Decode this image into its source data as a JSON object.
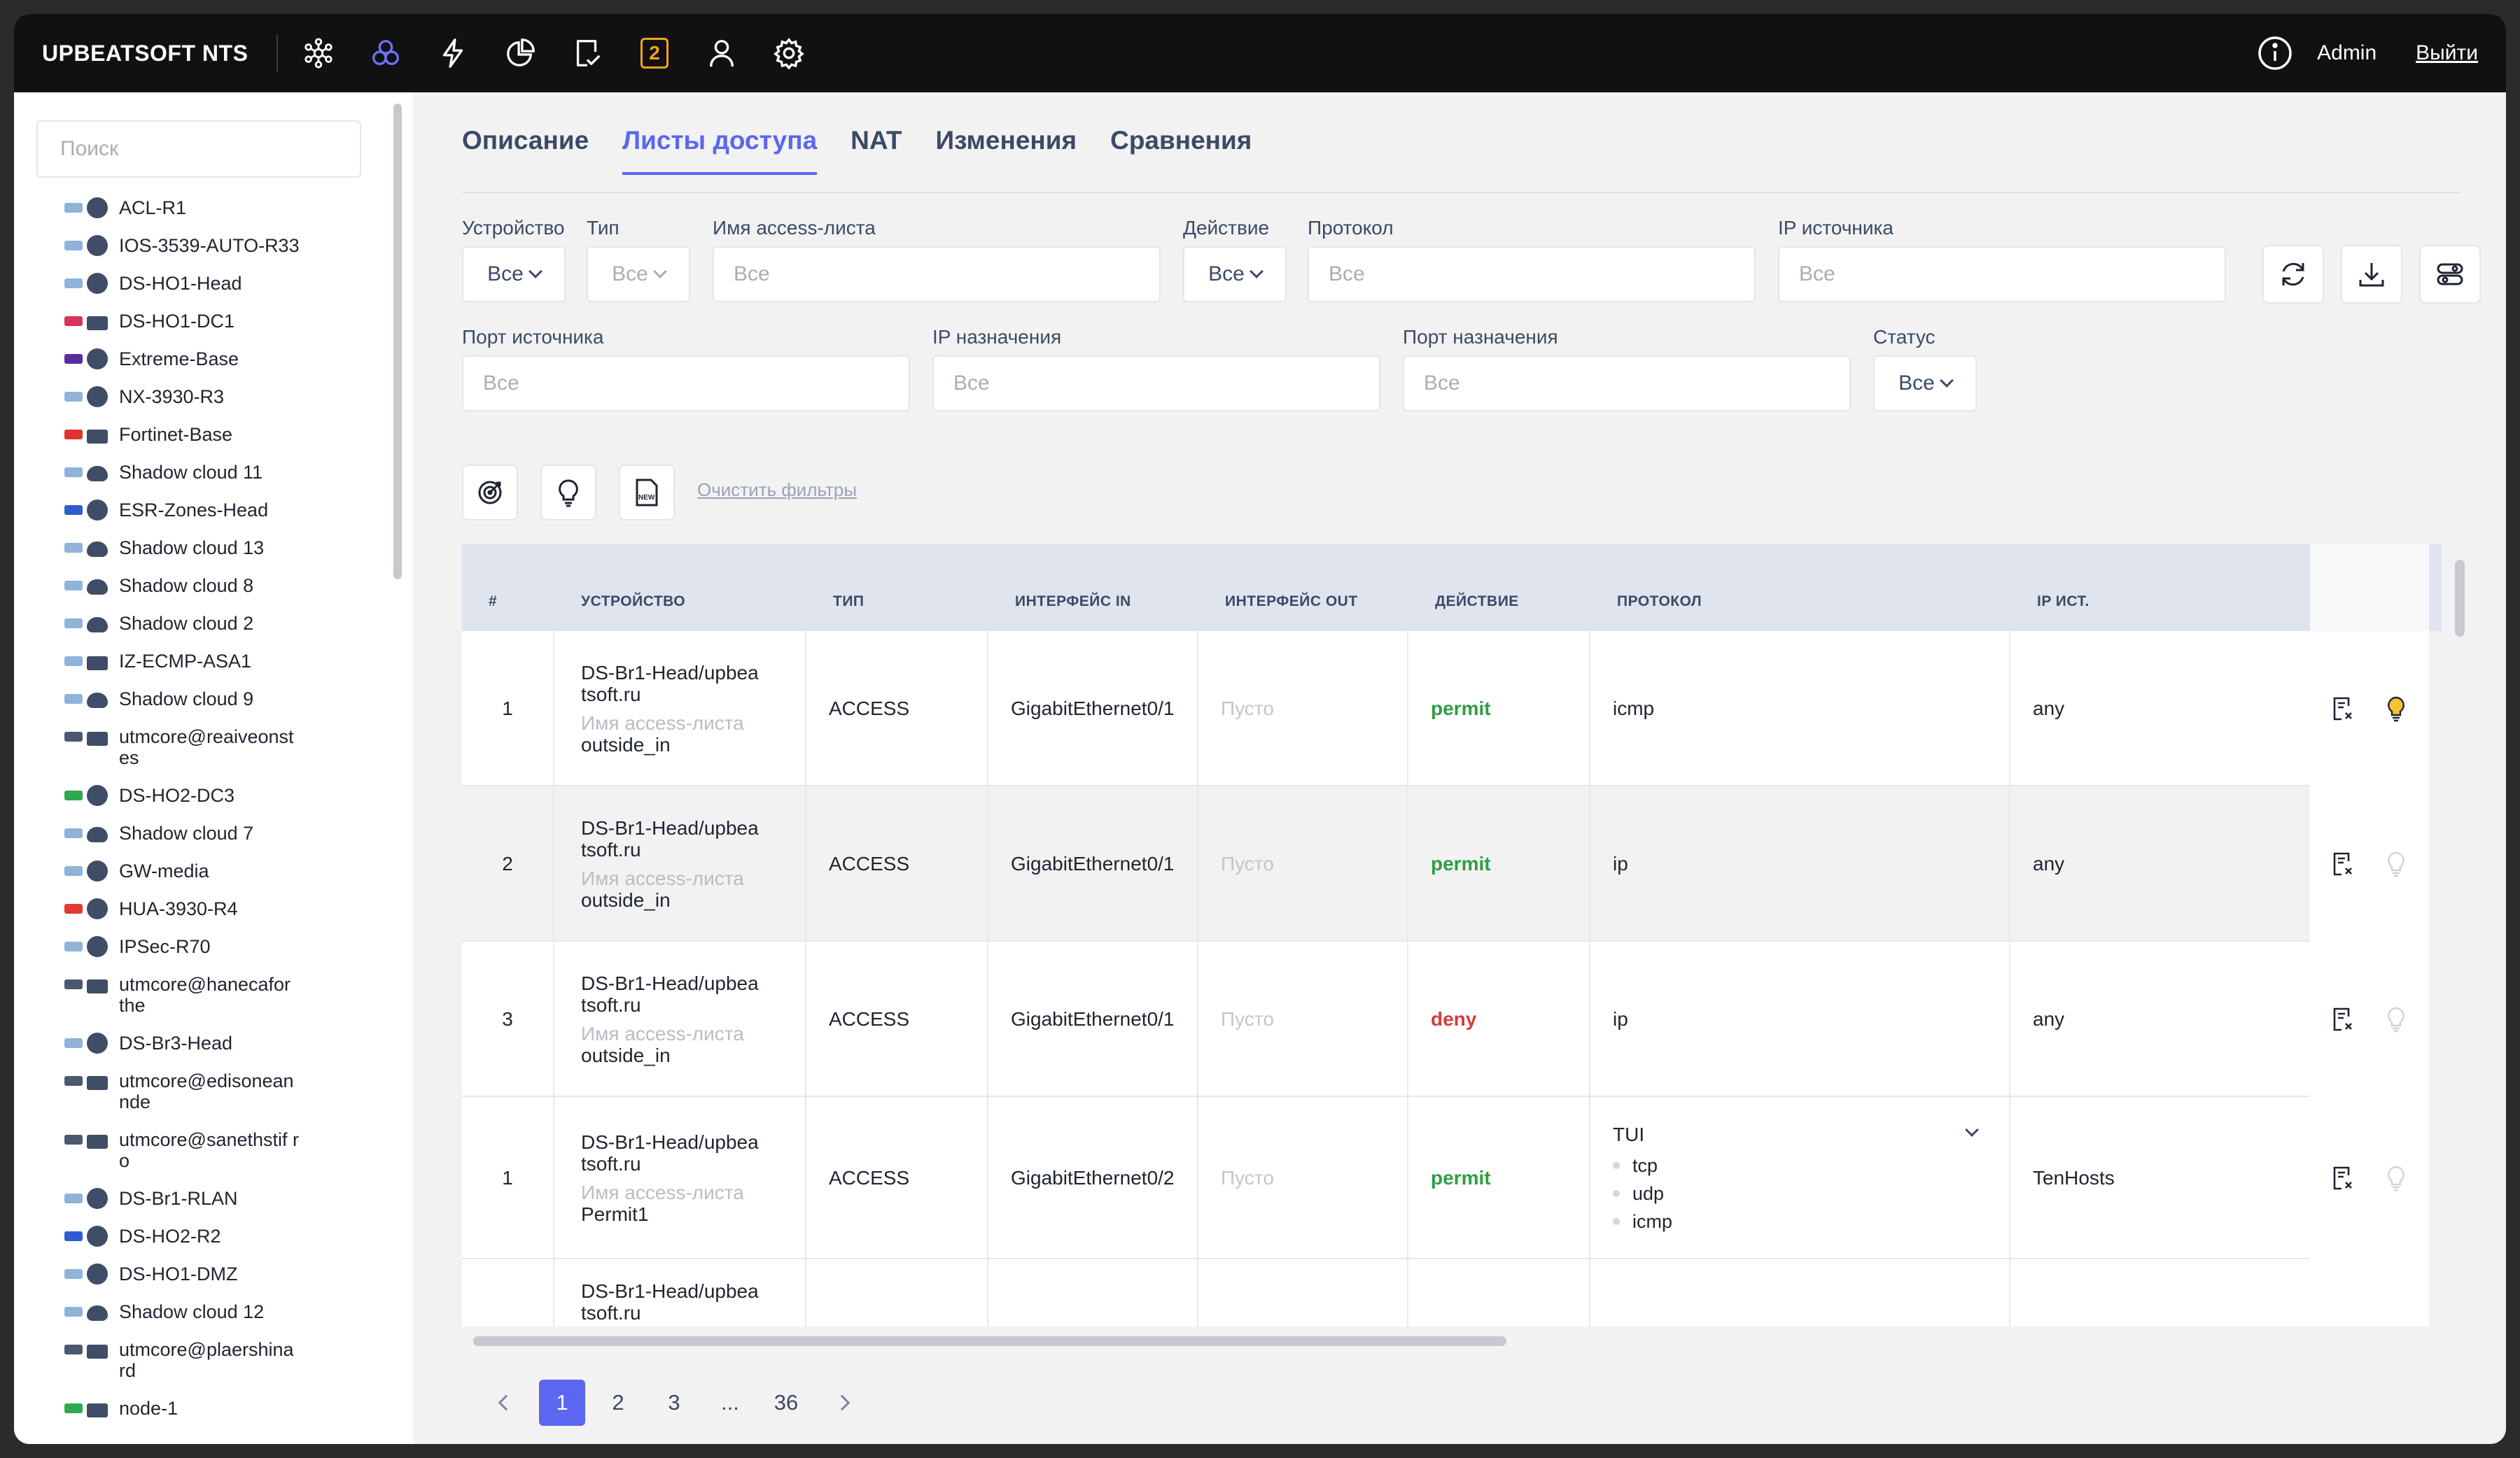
{
  "app": {
    "brand": "UPBEATSOFT NTS",
    "badge": "2",
    "user": "Admin",
    "logout": "Выйти"
  },
  "colors": {
    "accent": "#5b67f0",
    "permit": "#2f9e44",
    "deny": "#d63a3a",
    "badge": "#f4a21c",
    "topbar": "#111114"
  },
  "nav_icons": [
    "network-topology-icon",
    "clusters-icon",
    "lightning-icon",
    "pie-chart-icon",
    "document-check-icon",
    "notifications-badge-icon",
    "user-icon",
    "settings-icon"
  ],
  "sidebar": {
    "search_placeholder": "Поиск",
    "items": [
      {
        "label": "ACL-R1",
        "vendor": "cisco",
        "type": "router"
      },
      {
        "label": "IOS-3539-AUTO-R33",
        "vendor": "cisco",
        "type": "router"
      },
      {
        "label": "DS-HO1-Head",
        "vendor": "cisco",
        "type": "router"
      },
      {
        "label": "DS-HO1-DC1",
        "vendor": "checkpoint",
        "type": "firewall"
      },
      {
        "label": "Extreme-Base",
        "vendor": "extreme",
        "type": "router"
      },
      {
        "label": "NX-3930-R3",
        "vendor": "cisco",
        "type": "router"
      },
      {
        "label": "Fortinet-Base",
        "vendor": "fortinet",
        "type": "firewall"
      },
      {
        "label": "Shadow cloud 11",
        "vendor": "cisco",
        "type": "cloud"
      },
      {
        "label": "ESR-Zones-Head",
        "vendor": "eltex",
        "type": "router"
      },
      {
        "label": "Shadow cloud 13",
        "vendor": "cisco",
        "type": "cloud"
      },
      {
        "label": "Shadow cloud 8",
        "vendor": "cisco",
        "type": "cloud"
      },
      {
        "label": "Shadow cloud 2",
        "vendor": "cisco",
        "type": "cloud"
      },
      {
        "label": "IZ-ECMP-ASA1",
        "vendor": "cisco",
        "type": "firewall"
      },
      {
        "label": "Shadow cloud 9",
        "vendor": "cisco",
        "type": "cloud"
      },
      {
        "label": "utmcore@reaiveonst es",
        "vendor": "usergate",
        "type": "firewall"
      },
      {
        "label": "DS-HO2-DC3",
        "vendor": "green",
        "type": "router"
      },
      {
        "label": "Shadow cloud 7",
        "vendor": "cisco",
        "type": "cloud"
      },
      {
        "label": "GW-media",
        "vendor": "cisco",
        "type": "router"
      },
      {
        "label": "HUA-3930-R4",
        "vendor": "huawei",
        "type": "router"
      },
      {
        "label": "IPSec-R70",
        "vendor": "cisco",
        "type": "router"
      },
      {
        "label": "utmcore@hanecafor the",
        "vendor": "usergate",
        "type": "firewall"
      },
      {
        "label": "DS-Br3-Head",
        "vendor": "cisco",
        "type": "router"
      },
      {
        "label": "utmcore@edisonean nde",
        "vendor": "usergate",
        "type": "firewall"
      },
      {
        "label": "utmcore@sanethstif ro",
        "vendor": "usergate",
        "type": "firewall"
      },
      {
        "label": "DS-Br1-RLAN",
        "vendor": "cisco",
        "type": "router"
      },
      {
        "label": "DS-HO2-R2",
        "vendor": "eltex",
        "type": "router"
      },
      {
        "label": "DS-HO1-DMZ",
        "vendor": "cisco",
        "type": "router"
      },
      {
        "label": "Shadow cloud 12",
        "vendor": "cisco",
        "type": "cloud"
      },
      {
        "label": "utmcore@plaershina rd",
        "vendor": "usergate",
        "type": "firewall"
      },
      {
        "label": "node-1",
        "vendor": "green",
        "type": "firewall"
      }
    ]
  },
  "tabs": [
    "Описание",
    "Листы доступа",
    "NAT",
    "Изменения",
    "Сравнения"
  ],
  "filters": {
    "device_label": "Устройство",
    "device_value": "Все",
    "type_label": "Тип",
    "type_value": "Все",
    "acl_label": "Имя access-листа",
    "acl_placeholder": "Все",
    "action_label": "Действие",
    "action_value": "Все",
    "protocol_label": "Протокол",
    "protocol_placeholder": "Все",
    "src_ip_label": "IP источника",
    "src_ip_placeholder": "Все",
    "src_port_label": "Порт источника",
    "src_port_placeholder": "Все",
    "dst_ip_label": "IP назначения",
    "dst_ip_placeholder": "Все",
    "dst_port_label": "Порт назначения",
    "dst_port_placeholder": "Все",
    "status_label": "Статус",
    "status_value": "Все",
    "clear": "Очистить фильтры"
  },
  "table": {
    "headers": [
      "#",
      "УСТРОЙСТВО",
      "ТИП",
      "ИНТЕРФЕЙС IN",
      "ИНТЕРФЕЙС OUT",
      "ДЕЙСТВИЕ",
      "ПРОТОКОЛ",
      "IP ИСТ."
    ],
    "acl_name_label": "Имя access-листа",
    "rows": [
      {
        "num": "1",
        "device": "DS-Br1-Head/upbeatsoft.ru",
        "acl": "outside_in",
        "type": "ACCESS",
        "if_in": "GigabitEthernet0/1",
        "if_out": "Пусто",
        "action": "permit",
        "protocol": "icmp",
        "src_ip": "any"
      },
      {
        "num": "2",
        "device": "DS-Br1-Head/upbeatsoft.ru",
        "acl": "outside_in",
        "type": "ACCESS",
        "if_in": "GigabitEthernet0/1",
        "if_out": "Пусто",
        "action": "permit",
        "protocol": "ip",
        "src_ip": "any"
      },
      {
        "num": "3",
        "device": "DS-Br1-Head/upbeatsoft.ru",
        "acl": "outside_in",
        "type": "ACCESS",
        "if_in": "GigabitEthernet0/1",
        "if_out": "Пусто",
        "action": "deny",
        "protocol": "ip",
        "src_ip": "any"
      },
      {
        "num": "1",
        "device": "DS-Br1-Head/upbeatsoft.ru",
        "acl": "Permit1",
        "type": "ACCESS",
        "if_in": "GigabitEthernet0/2",
        "if_out": "Пусто",
        "action": "permit",
        "protocol_group": "TUI",
        "protocol_items": [
          "tcp",
          "udp",
          "icmp"
        ],
        "src_ip": "TenHosts"
      },
      {
        "num": "",
        "device": "DS-Br1-Head/upbeatsoft.ru"
      }
    ]
  },
  "pagination": {
    "pages": [
      "1",
      "2",
      "3",
      "...",
      "36"
    ],
    "current": "1"
  }
}
